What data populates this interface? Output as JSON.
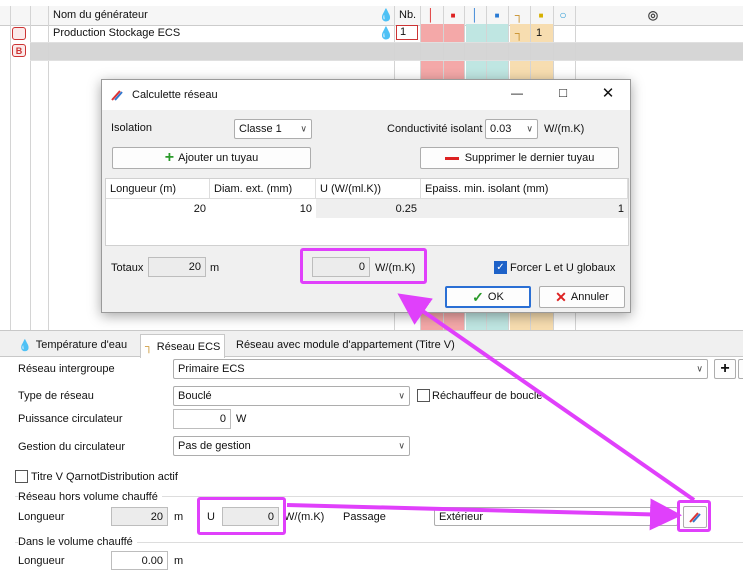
{
  "grid": {
    "header_name": "Nom du générateur",
    "header_nb": "Nb.",
    "row1_name": "Production Stockage ECS",
    "row1_nb": "1",
    "row1_val": "1",
    "row2_icon_letter": "B"
  },
  "dialog": {
    "title": "Calculette réseau",
    "isolation_label": "Isolation",
    "isolation_value": "Classe 1",
    "conductivity_label": "Conductivité isolant",
    "conductivity_value": "0.03",
    "conductivity_unit": "W/(m.K)",
    "add_pipe": "Ajouter un tuyau",
    "remove_pipe": "Supprimer le dernier tuyau",
    "columns": [
      "Longueur (m)",
      "Diam. ext. (mm)",
      "U (W/(ml.K))",
      "Epaiss. min. isolant (mm)"
    ],
    "row": [
      "20",
      "10",
      "0.25",
      "1"
    ],
    "totals_label": "Totaux",
    "totals_length": "20",
    "totals_length_unit": "m",
    "totals_u": "0",
    "totals_u_unit": "W/(m.K)",
    "force_label": "Forcer L et U globaux",
    "ok": "OK",
    "cancel": "Annuler"
  },
  "tabs": [
    {
      "label": "Température d'eau"
    },
    {
      "label": "Réseau ECS"
    },
    {
      "label": "Réseau avec module d'appartement (Titre V)"
    }
  ],
  "form": {
    "reseau_intergroupe_label": "Réseau intergroupe",
    "reseau_intergroupe_value": "Primaire ECS",
    "type_reseau_label": "Type de réseau",
    "type_reseau_value": "Bouclé",
    "rechauffeur_label": "Réchauffeur de boucle",
    "puissance_label": "Puissance circulateur",
    "puissance_value": "0",
    "puissance_unit": "W",
    "gestion_label": "Gestion du circulateur",
    "gestion_value": "Pas de gestion",
    "titre_v_label": "Titre V QarnotDistribution actif",
    "hors_volume_title": "Réseau hors volume chauffé",
    "longueur_label": "Longueur",
    "longueur_value": "20",
    "longueur_unit": "m",
    "u_label": "U",
    "u_value": "0",
    "u_unit": "W/(m.K)",
    "passage_label": "Passage",
    "passage_value": "Extérieur",
    "dans_volume_title": "Dans le volume chauffé",
    "longueur2_label": "Longueur",
    "longueur2_value": "0.00",
    "longueur2_unit": "m"
  },
  "colors": {
    "red_col": "#f4a8a8",
    "teal_col": "#bfe6e2",
    "yellow_col": "#f7ddb0",
    "highlight": "#e040fb"
  }
}
